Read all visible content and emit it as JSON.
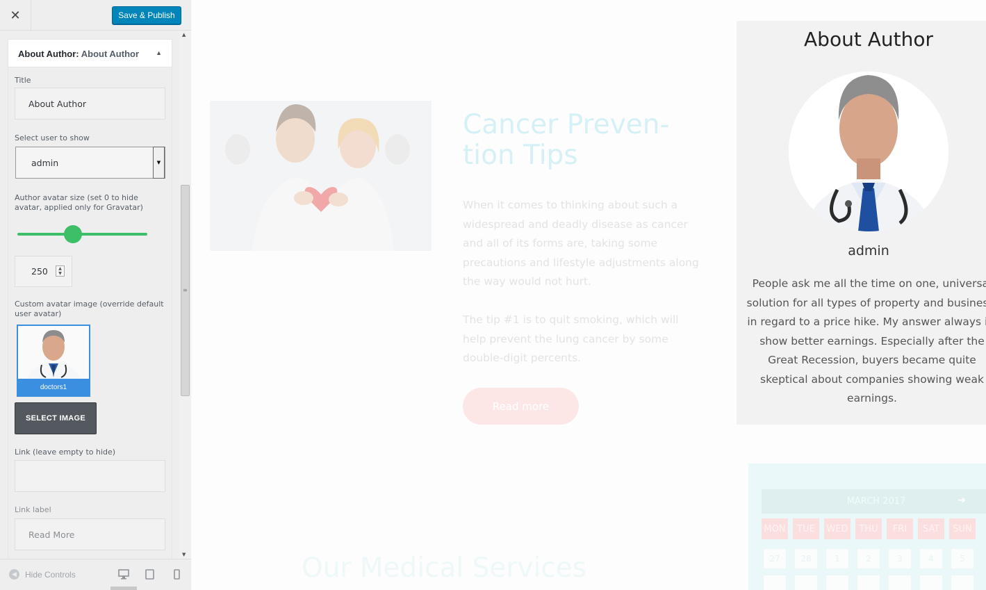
{
  "topbar": {
    "close_glyph": "✕",
    "publish_label": "Save & Publish"
  },
  "panel": {
    "title_prefix": "About Author:",
    "title_sub": "About Author",
    "fields": {
      "title_label": "Title",
      "title_value": "About Author",
      "user_label": "Select user to show",
      "user_value": "admin",
      "avatar_size_label": "Author avatar size (set 0 to hide avatar, applied only for Gravatar)",
      "avatar_size_fraction": 0.43,
      "avatar_size_value": "250",
      "custom_avatar_label": "Custom avatar image (override default user avatar)",
      "custom_avatar_filename": "doctors1",
      "select_image_label": "SELECT IMAGE",
      "link_label": "Link (leave empty to hide)",
      "link_value": "",
      "link_label_label": "Link label",
      "link_label_value": "Read More"
    }
  },
  "footer": {
    "hide_controls_label": "Hide Controls"
  },
  "preview": {
    "post_title": "Cancer Preven-tion Tips",
    "post_para_1": "When it comes to thinking about such a widespread and deadly disease as cancer and all of its forms are, taking some precautions and lifestyle adjustments along the way would not hurt.",
    "post_para_2": "The tip #1 is to quit smoking, which will help prevent the lung cancer by some double-digit percents.",
    "read_more": "Read more",
    "services_title": "Our Medical Services",
    "author": {
      "title": "About Author",
      "name": "admin",
      "bio": "People ask me all the time on one, universal solution for all types of property and business, in regard to a price hike. My answer always is: show better earnings. Especially after the Great Recession, buyers became quite skeptical about companies showing weak earnings."
    },
    "calendar": {
      "month": "MARCH 2017",
      "days": [
        "MON",
        "TUE",
        "WED",
        "THU",
        "FRI",
        "SAT",
        "SUN"
      ],
      "dates": [
        "27",
        "28",
        "1",
        "2",
        "3",
        "4",
        "5"
      ]
    }
  },
  "colors": {
    "accent": "#0085ba",
    "slider": "#3dbf67",
    "selection": "#3b8fe0"
  }
}
